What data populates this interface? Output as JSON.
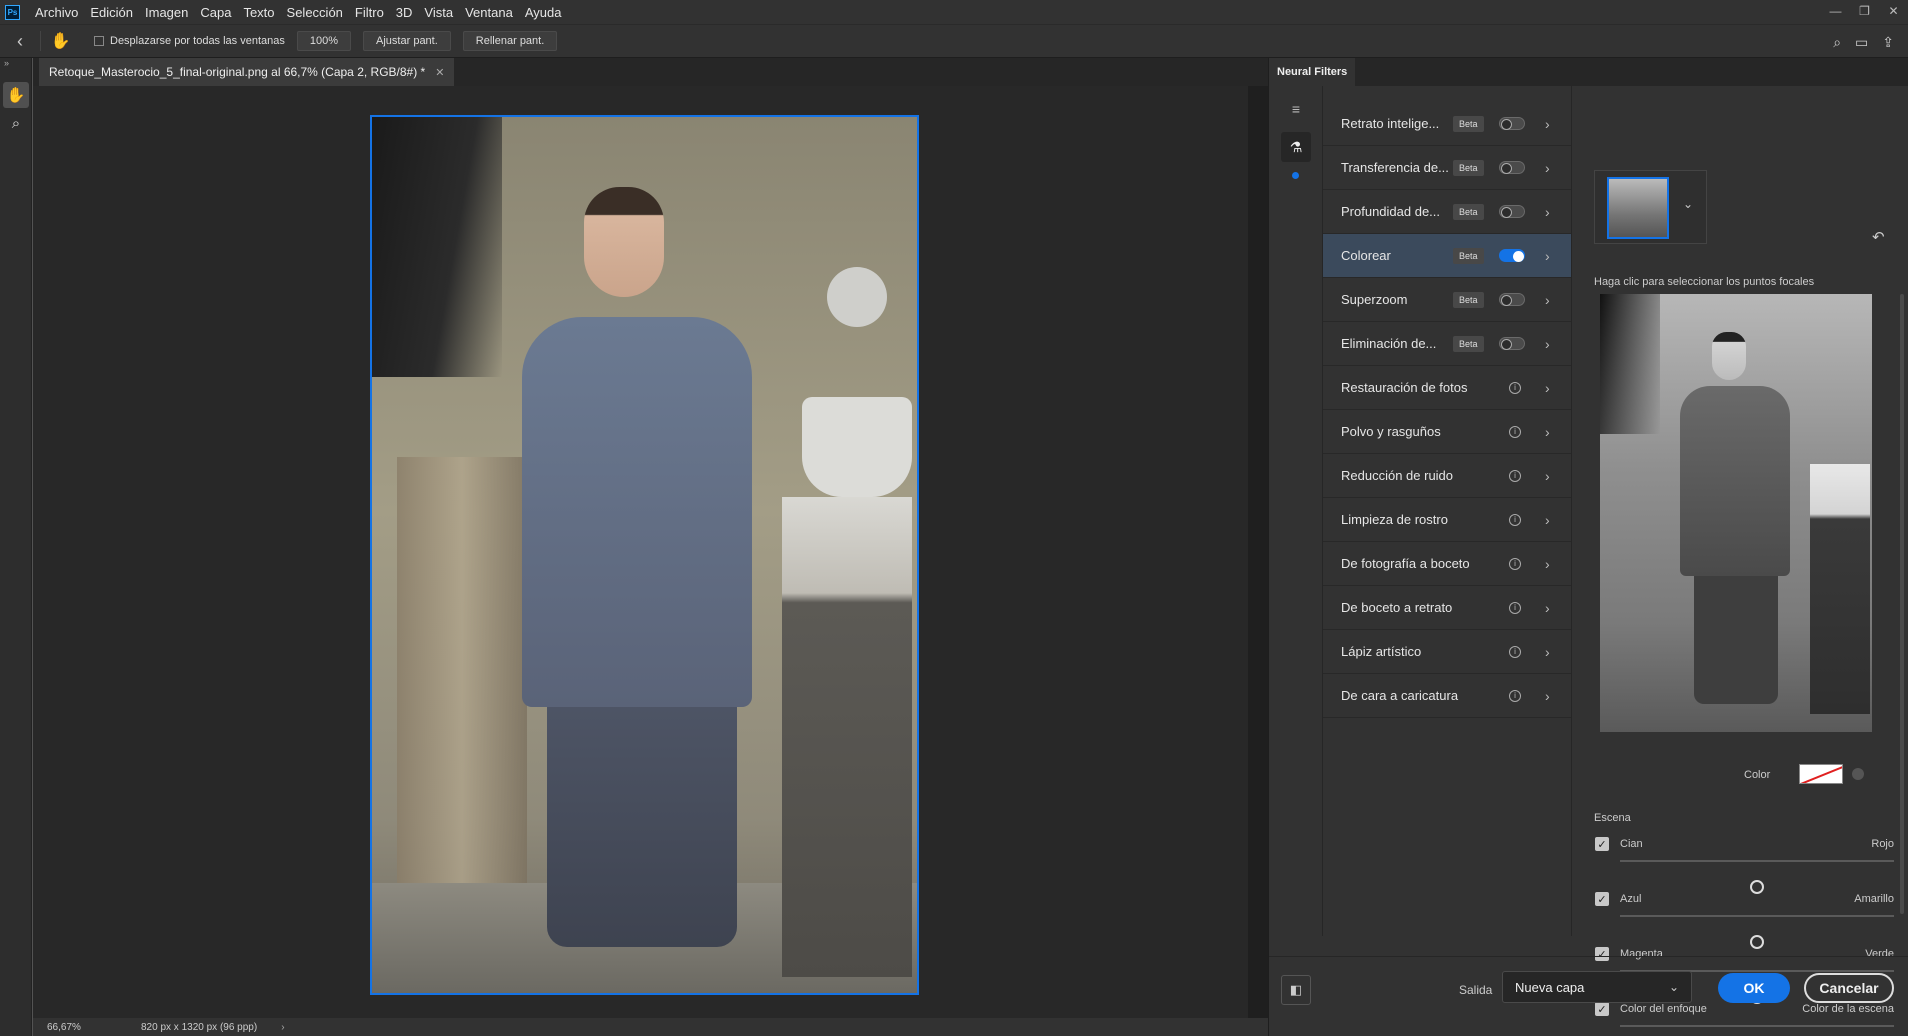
{
  "menubar": {
    "logo": "Ps",
    "items": [
      "Archivo",
      "Edición",
      "Imagen",
      "Capa",
      "Texto",
      "Selección",
      "Filtro",
      "3D",
      "Vista",
      "Ventana",
      "Ayuda"
    ],
    "window_controls": [
      "minimize-icon",
      "restore-icon",
      "close-icon"
    ]
  },
  "options": {
    "scroll_all_label": "Desplazarse por todas las ventanas",
    "zoom_value": "100%",
    "fit_label": "Ajustar pant.",
    "fill_label": "Rellenar pant."
  },
  "document": {
    "tab_title": "Retoque_Masterocio_5_final-original.png al 66,7% (Capa 2, RGB/8#) *"
  },
  "status": {
    "zoom": "66,67%",
    "dimensions": "820 px x 1320 px (96 ppp)"
  },
  "panel": {
    "title": "Neural Filters",
    "filters": [
      {
        "name": "Retrato intelige...",
        "beta": "Beta",
        "enabled": false
      },
      {
        "name": "Transferencia de...",
        "beta": "Beta",
        "enabled": false
      },
      {
        "name": "Profundidad de...",
        "beta": "Beta",
        "enabled": false
      },
      {
        "name": "Colorear",
        "beta": "Beta",
        "enabled": true
      },
      {
        "name": "Superzoom",
        "beta": "Beta",
        "enabled": false
      },
      {
        "name": "Eliminación de...",
        "beta": "Beta",
        "enabled": false
      },
      {
        "name": "Restauración de fotos",
        "beta": "",
        "enabled": null
      },
      {
        "name": "Polvo y rasguños",
        "beta": "",
        "enabled": null
      },
      {
        "name": "Reducción de ruido",
        "beta": "",
        "enabled": null
      },
      {
        "name": "Limpieza de rostro",
        "beta": "",
        "enabled": null
      },
      {
        "name": "De fotografía a boceto",
        "beta": "",
        "enabled": null
      },
      {
        "name": "De boceto a retrato",
        "beta": "",
        "enabled": null
      },
      {
        "name": "Lápiz artístico",
        "beta": "",
        "enabled": null
      },
      {
        "name": "De cara a caricatura",
        "beta": "",
        "enabled": null
      }
    ],
    "focal_hint": "Haga clic para seleccionar los puntos focales",
    "color_label": "Color",
    "scene_label": "Escena",
    "sliders": [
      {
        "left": "Cian",
        "right": "Rojo",
        "checked": true,
        "value": 0
      },
      {
        "left": "Azul",
        "right": "Amarillo",
        "checked": true,
        "value": 0
      },
      {
        "left": "Magenta",
        "right": "Verde",
        "checked": true,
        "value": 0
      },
      {
        "left": "Color del enfoque",
        "right": "Color de la escena",
        "checked": true,
        "value": 0
      }
    ],
    "output_label": "Salida",
    "output_value": "Nueva capa",
    "ok_label": "OK",
    "cancel_label": "Cancelar"
  }
}
